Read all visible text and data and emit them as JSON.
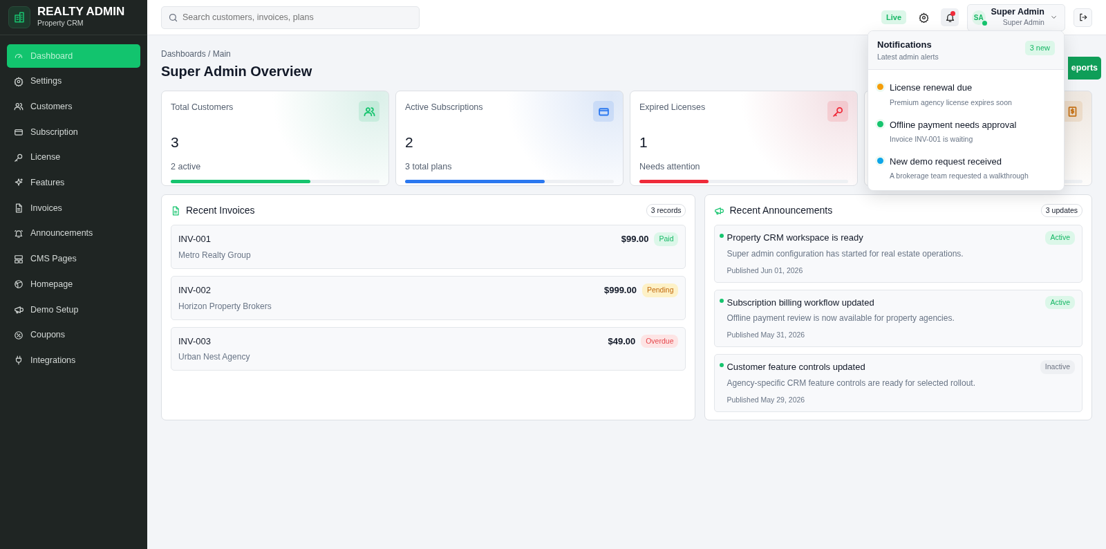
{
  "brand": {
    "title": "REALTY ADMIN",
    "subtitle": "Property CRM"
  },
  "sidebar": {
    "items": [
      {
        "label": "Dashboard",
        "selected": true
      },
      {
        "label": "Settings",
        "selected": false
      },
      {
        "label": "Customers",
        "selected": false
      },
      {
        "label": "Subscription",
        "selected": false
      },
      {
        "label": "License",
        "selected": false
      },
      {
        "label": "Features",
        "selected": false
      },
      {
        "label": "Invoices",
        "selected": false
      },
      {
        "label": "Announcements",
        "selected": false
      },
      {
        "label": "CMS Pages",
        "selected": false
      },
      {
        "label": "Homepage",
        "selected": false
      },
      {
        "label": "Demo Setup",
        "selected": false
      },
      {
        "label": "Coupons",
        "selected": false
      },
      {
        "label": "Integrations",
        "selected": false
      }
    ]
  },
  "header": {
    "search": {
      "placeholder": "Search customers, invoices, plans"
    },
    "status_badge": "Live",
    "notifications_unread": true,
    "user": {
      "initials": "SA",
      "name": "Super Admin",
      "role": "Super Admin",
      "online": true
    }
  },
  "breadcrumb": "Dashboards / Main",
  "page_title": "Super Admin Overview",
  "header_button": "eports",
  "stat_cards": [
    {
      "label": "Total Customers",
      "value": "3",
      "note": "2 active",
      "level": 0.67,
      "color": "#16c46e"
    },
    {
      "label": "Active Subscriptions",
      "value": "2",
      "note": "3 total plans",
      "level": 0.67,
      "color": "#2b78f0"
    },
    {
      "label": "Expired Licenses",
      "value": "1",
      "note": "Needs attention",
      "level": 0.33,
      "color": "#ef2b3a"
    },
    {
      "color": "#c8751a"
    }
  ],
  "invoices": {
    "title": "Recent Invoices",
    "count": "3 records",
    "rows": [
      {
        "number": "INV-001",
        "customer": "Metro Realty Group",
        "amount": "$99.00",
        "status": "Paid",
        "kind": "paid"
      },
      {
        "number": "INV-002",
        "customer": "Horizon Property Brokers",
        "amount": "$999.00",
        "status": "Pending",
        "kind": "pending"
      },
      {
        "number": "INV-003",
        "customer": "Urban Nest Agency",
        "amount": "$49.00",
        "status": "Overdue",
        "kind": "overdue"
      }
    ]
  },
  "announcements": {
    "title": "Recent Announcements",
    "count": "3 updates",
    "items": [
      {
        "title": "Property CRM workspace is ready",
        "body": "Super admin configuration has started for real estate operations.",
        "date": "Published Jun 01, 2026",
        "status": "Active",
        "active": true
      },
      {
        "title": "Subscription billing workflow updated",
        "body": "Offline payment review is now available for property agencies.",
        "date": "Published May 31, 2026",
        "status": "Active",
        "active": true
      },
      {
        "title": "Customer feature controls updated",
        "body": "Agency-specific CRM feature controls are ready for selected rollout.",
        "date": "Published May 29, 2026",
        "status": "Inactive",
        "active": false
      }
    ]
  },
  "notifications": {
    "title": "Notifications",
    "subtitle": "Latest admin alerts",
    "badge": "3 new",
    "items": [
      {
        "title": "License renewal due",
        "detail": "Premium agency license expires soon",
        "color": "#f59e0b"
      },
      {
        "title": "Offline payment needs approval",
        "detail": "Invoice INV-001 is waiting",
        "color": "#16c46e"
      },
      {
        "title": "New demo request received",
        "detail": "A brokerage team requested a walkthrough",
        "color": "#0ea5e9"
      }
    ]
  }
}
